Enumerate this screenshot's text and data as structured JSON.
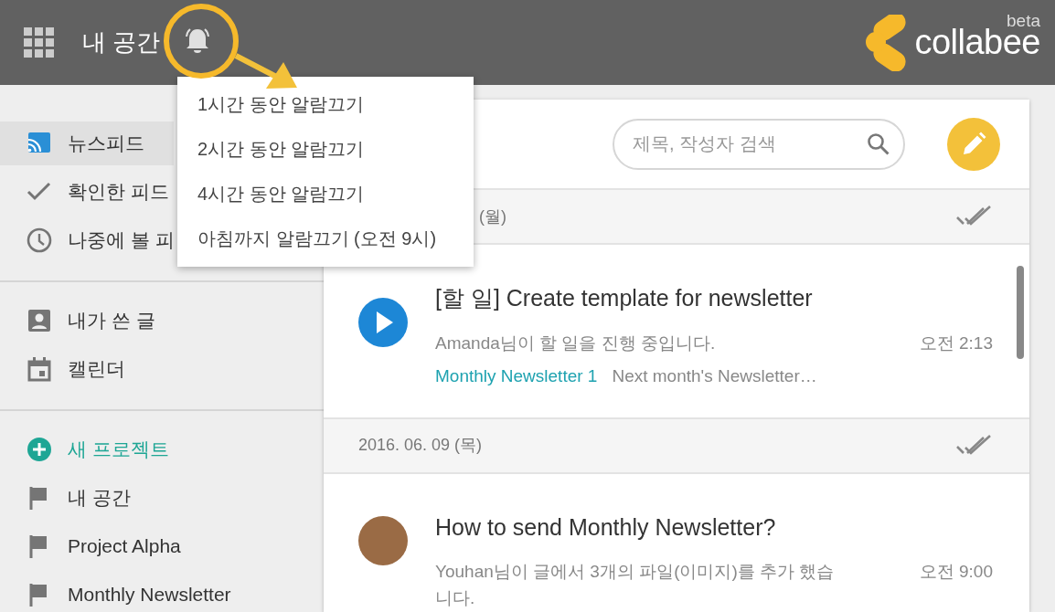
{
  "header": {
    "app_title": "내 공간",
    "logo": {
      "name": "collabee",
      "tag": "beta"
    }
  },
  "notify_menu": {
    "items": [
      {
        "label": "1시간 동안 알람끄기"
      },
      {
        "label": "2시간 동안 알람끄기"
      },
      {
        "label": "4시간 동안 알람끄기"
      },
      {
        "label": "아침까지 알람끄기 (오전 9시)"
      }
    ]
  },
  "sidebar": {
    "sections": [
      [
        {
          "kind": "feed",
          "label": "뉴스피드",
          "selected": true
        },
        {
          "kind": "check",
          "label": "확인한 피드",
          "selected": false
        },
        {
          "kind": "clock",
          "label": "나중에 볼 피",
          "selected": false
        }
      ],
      [
        {
          "kind": "person",
          "label": "내가 쓴 글",
          "selected": false
        },
        {
          "kind": "calendar",
          "label": "캘린더",
          "selected": false
        }
      ],
      [
        {
          "kind": "add",
          "label": "새 프로젝트",
          "selected": false
        },
        {
          "kind": "flag",
          "label": "내 공간",
          "selected": false
        },
        {
          "kind": "flag",
          "label": "Project Alpha",
          "selected": false
        },
        {
          "kind": "flag",
          "label": "Monthly Newsletter",
          "selected": false
        }
      ]
    ]
  },
  "feed": {
    "search": {
      "placeholder": "제목, 작성자 검색"
    },
    "groups": [
      {
        "date": "(월)",
        "items": [
          {
            "kind": "task",
            "title": "[할 일] Create template for newsletter",
            "summary": "Amanda님이 할 일을 진행 중입니다.",
            "time": "오전 2:13",
            "project": "Monthly Newsletter 1",
            "preview": "Next month's Newsletter…"
          }
        ]
      },
      {
        "date": "2016. 06. 09 (목)",
        "items": [
          {
            "kind": "post",
            "title": "How to send Monthly Newsletter?",
            "summary": "Youhan님이 글에서 3개의 파일(이미지)를 추가 했습니다.",
            "time": "오전 9:00"
          }
        ]
      }
    ]
  }
}
